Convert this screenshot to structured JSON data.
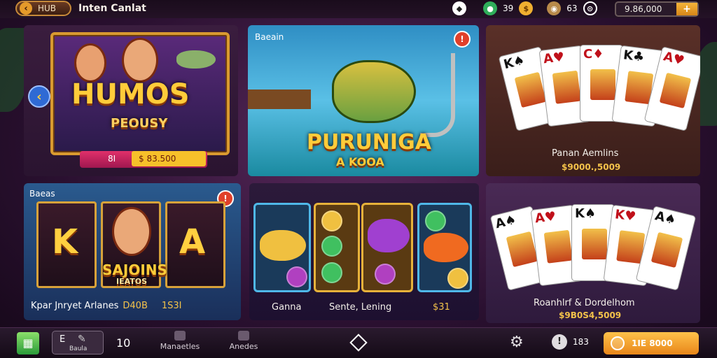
{
  "header": {
    "back_label": "HUB",
    "title": "Inten Canlat",
    "stat_a": "39",
    "stat_b": "63",
    "balance": "9.86,000",
    "plus": "+"
  },
  "tiles": {
    "humos": {
      "logo": "HUMOS",
      "sub": "PEOUSY",
      "pill_left": "8I",
      "pill_right": "$ 83.500"
    },
    "fishing": {
      "tag": "Baeain",
      "logo": "PURUNIGA",
      "sub": "A KOOA",
      "badge": "!"
    },
    "poker1": {
      "caption": "Panan Aemlins",
      "amount": "$9000.,5009"
    },
    "slots": {
      "tag": "Baeas",
      "badge": "!",
      "logo": "SAJOINS",
      "sub": "IEATOS",
      "caption": "Kpar Jnryet Arlanes",
      "value_a": "D40B",
      "value_b": "1S3I"
    },
    "reels": {
      "col1": "Ganna",
      "col2": "Sente, Lening",
      "col3": "$31"
    },
    "poker2": {
      "caption": "Roanhlrf & Dordelhom",
      "amount": "$9B0S4,5009"
    }
  },
  "cards_top": [
    {
      "rank": "K",
      "suit": "♠",
      "color": "black"
    },
    {
      "rank": "A",
      "suit": "♥",
      "color": "red"
    },
    {
      "rank": "C",
      "suit": "♦",
      "color": "red"
    },
    {
      "rank": "K",
      "suit": "♣",
      "color": "black"
    },
    {
      "rank": "A",
      "suit": "♥",
      "color": "red"
    }
  ],
  "cards_bottom": [
    {
      "rank": "A",
      "suit": "♠",
      "color": "black"
    },
    {
      "rank": "A",
      "suit": "♥",
      "color": "red"
    },
    {
      "rank": "K",
      "suit": "♠",
      "color": "black"
    },
    {
      "rank": "K",
      "suit": "♥",
      "color": "red"
    },
    {
      "rank": "A",
      "suit": "♠",
      "color": "black"
    }
  ],
  "bottombar": {
    "menu_label": "E",
    "chip_label": "Baula",
    "count": "10",
    "nav1": "Manaetles",
    "nav2": "Anedes",
    "count_b": "183",
    "cta_label": "1IE 8000"
  }
}
